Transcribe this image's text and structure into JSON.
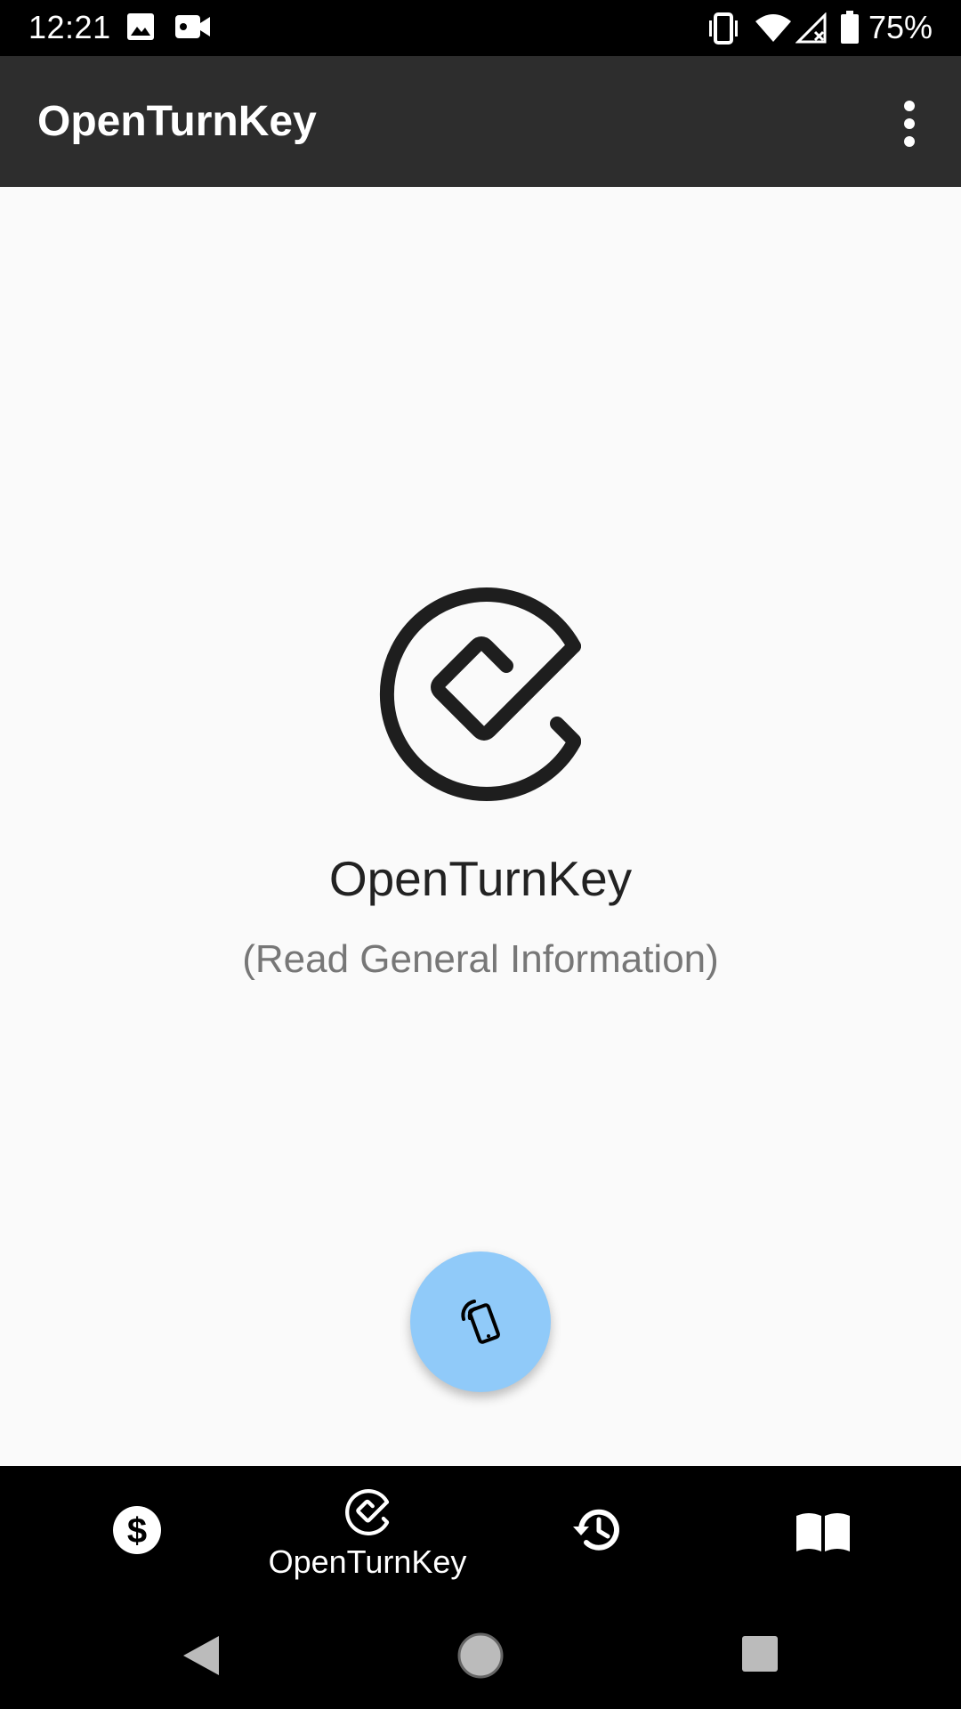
{
  "status_bar": {
    "time": "12:21",
    "battery_percent": "75%",
    "icons": [
      "image-icon",
      "video-camera-icon",
      "vibrate-icon",
      "wifi-icon",
      "cell-signal-off-icon",
      "battery-icon"
    ]
  },
  "app_bar": {
    "title": "OpenTurnKey",
    "menu_icon": "more-vert-icon"
  },
  "main": {
    "logo_icon": "openturnkey-logo-icon",
    "title": "OpenTurnKey",
    "subtitle": "(Read General Information)",
    "fab_icon": "nfc-phone-icon",
    "fab_color": "#90caf9"
  },
  "bottom_nav": {
    "items": [
      {
        "icon": "dollar-icon",
        "label": "",
        "active": false
      },
      {
        "icon": "openturnkey-icon",
        "label": "OpenTurnKey",
        "active": true
      },
      {
        "icon": "history-icon",
        "label": "",
        "active": false
      },
      {
        "icon": "book-icon",
        "label": "",
        "active": false
      }
    ]
  },
  "system_nav": {
    "buttons": [
      "back-icon",
      "home-icon",
      "recents-icon"
    ]
  },
  "colors": {
    "status_bar": "#000000",
    "app_bar": "#2d2d2d",
    "background": "#fafafa",
    "bottom_nav": "#000000",
    "accent": "#90caf9"
  }
}
